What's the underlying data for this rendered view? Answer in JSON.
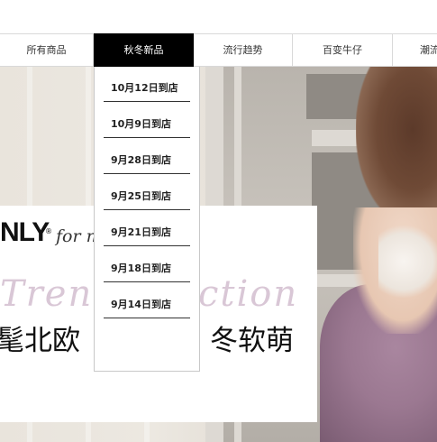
{
  "nav": {
    "items": [
      {
        "label": "所有商品",
        "active": false
      },
      {
        "label": "秋冬新品",
        "active": true
      },
      {
        "label": "流行趋势",
        "active": false
      },
      {
        "label": "百变牛仔",
        "active": false
      },
      {
        "label": "潮流",
        "active": false
      }
    ]
  },
  "dropdown": {
    "items": [
      "10月12日到店",
      "10月9日到店",
      "9月28日到店",
      "9月25日到店",
      "9月21日到店",
      "9月18日到店",
      "9月14日到店"
    ]
  },
  "banner": {
    "brand": "NLY",
    "registered_mark": "®",
    "tagline": "for m",
    "script_text_left": "Trend",
    "script_text_right": "ction",
    "headline_left": "髦北欧",
    "headline_right": "冬软萌"
  },
  "colors": {
    "nav_active_bg": "#000000",
    "nav_active_text": "#ffffff",
    "sweater": "#9b7891",
    "hair": "#5c3a2a"
  }
}
